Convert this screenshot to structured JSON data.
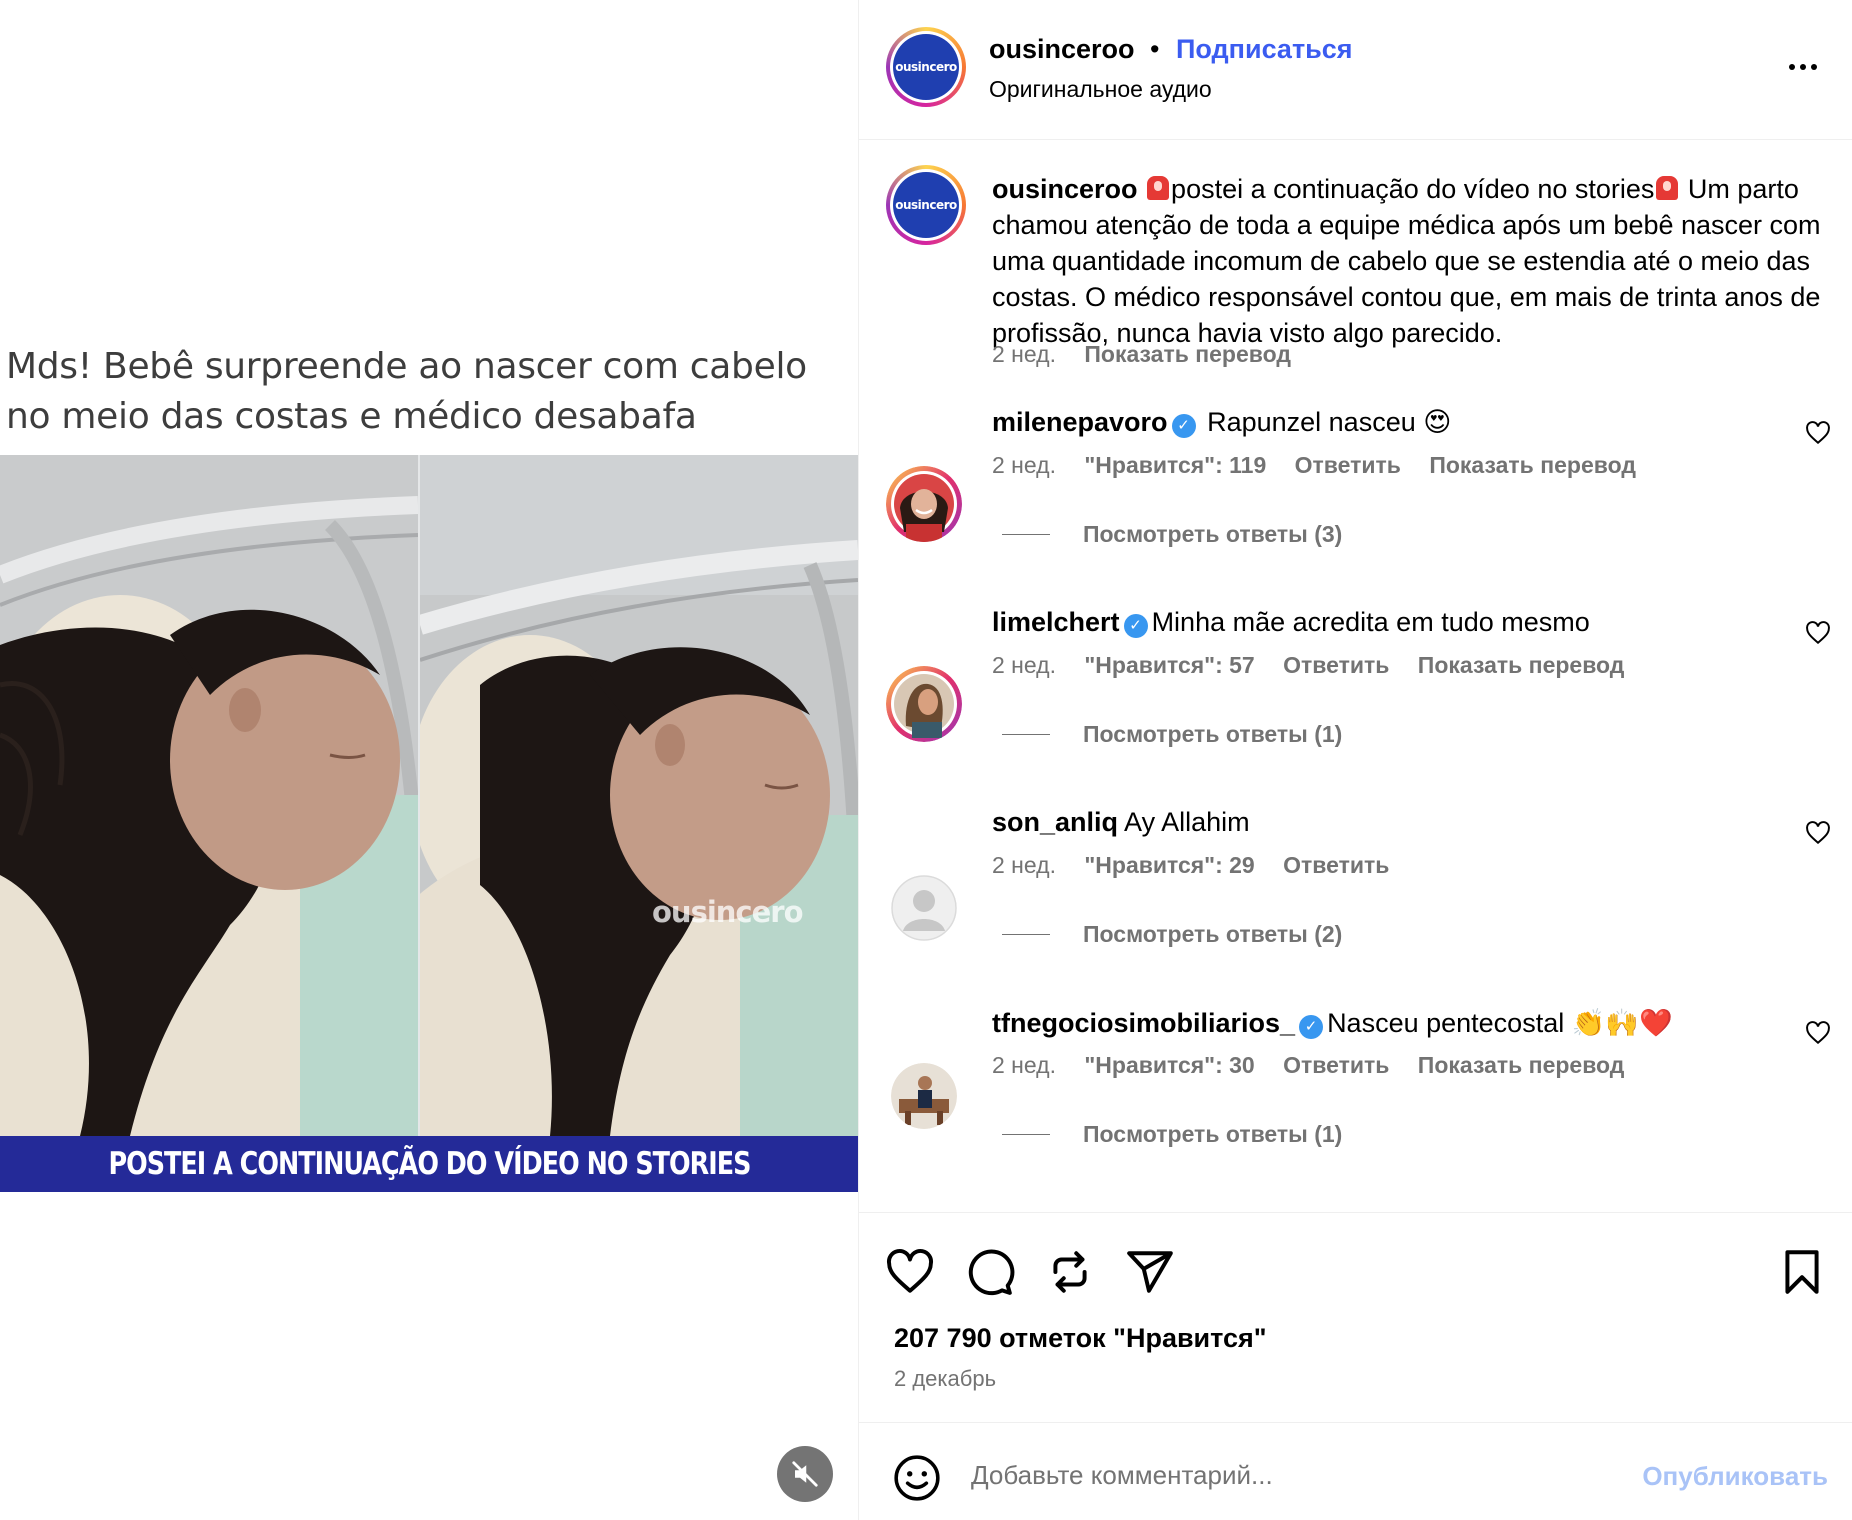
{
  "media": {
    "headline": "Mds! Bebê surpreende ao nascer com cabelo no meio das costas e médico desabafa",
    "watermark": "ousincero",
    "banner": "POSTEI A CONTINUAÇÃO DO VÍDEO NO STORIES",
    "mute_icon": "speaker-muted-icon"
  },
  "header": {
    "username": "ousinceroo",
    "separator": "•",
    "follow": "Подписаться",
    "audio": "Оригинальное аудио",
    "avatar_text": "ousincero",
    "more_icon": "more-options-icon"
  },
  "caption": {
    "username": "ousinceroo",
    "part1": "postei a continuação do vídeo no stories",
    "part2": " Um parto chamou atenção de toda a equipe médica após um bebê nascer com uma quantidade incomum de cabelo que se estendia até o meio das costas. O médico responsável contou que, em mais de trinta anos de profissão, nunca havia visto algo parecido.",
    "time": "2 нед.",
    "translate": "Показать перевод"
  },
  "comments": [
    {
      "username": "milenepavoro",
      "verified": true,
      "text": "Rapunzel nasceu 😍",
      "time": "2 нед.",
      "likes": "\"Нравится\": 119",
      "reply": "Ответить",
      "translate": "Показать перевод",
      "view_replies": "Посмотреть ответы (3)"
    },
    {
      "username": "limelchert",
      "verified": true,
      "text": "Minha mãe acredita em tudo mesmo",
      "time": "2 нед.",
      "likes": "\"Нравится\": 57",
      "reply": "Ответить",
      "translate": "Показать перевод",
      "view_replies": "Посмотреть ответы (1)"
    },
    {
      "username": "son_anliq",
      "verified": false,
      "text": "Ay Allahim",
      "time": "2 нед.",
      "likes": "\"Нравится\": 29",
      "reply": "Ответить",
      "translate": "",
      "view_replies": "Посмотреть ответы (2)"
    },
    {
      "username": "tfnegociosimobiliarios_",
      "verified": true,
      "text": "Nasceu pentecostal 👏🙌❤️",
      "time": "2 нед.",
      "likes": "\"Нравится\": 30",
      "reply": "Ответить",
      "translate": "Показать перевод",
      "view_replies": "Посмотреть ответы (1)"
    }
  ],
  "verified_mark": "✓",
  "actions": {
    "likes": "207 790 отметок \"Нравится\"",
    "date": "2 декабрь"
  },
  "composer": {
    "placeholder": "Добавьте комментарий...",
    "publish": "Опубликовать"
  },
  "colors": {
    "link_blue": "#3b5cf0",
    "verified_blue": "#3897f0",
    "banner_blue": "#242a98",
    "secondary_text": "#737373",
    "publish_disabled": "#a9c3f7"
  }
}
